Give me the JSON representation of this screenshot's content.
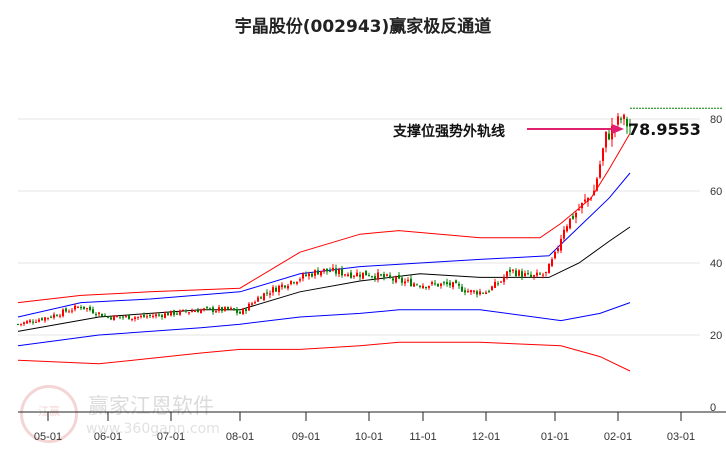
{
  "title": "宇晶股份(002943)赢家极反通道",
  "watermark": {
    "name": "赢家江恩软件",
    "url": "www.360gann.com",
    "seal": "江赢恩家"
  },
  "annotation": {
    "label": "支撑位强势外轨线",
    "value": "78.9553"
  },
  "colors": {
    "up": "#ff0000",
    "down": "#008000",
    "mid": "#000000",
    "inner": "#0000ff",
    "outer": "#ff0000",
    "arrow": "#e0206f"
  },
  "chart_data": {
    "type": "candlestick",
    "title": "宇晶股份(002943)赢家极反通道",
    "ylim": [
      0,
      85
    ],
    "xlim": [
      0,
      228
    ],
    "yticks": [
      0,
      20,
      40,
      60,
      80
    ],
    "xticks": [
      {
        "i": 10,
        "label": "05-01"
      },
      {
        "i": 30,
        "label": "06-01"
      },
      {
        "i": 51,
        "label": "07-01"
      },
      {
        "i": 74,
        "label": "08-01"
      },
      {
        "i": 96,
        "label": "09-01"
      },
      {
        "i": 117,
        "label": "10-01"
      },
      {
        "i": 135,
        "label": "11-01"
      },
      {
        "i": 156,
        "label": "12-01"
      },
      {
        "i": 179,
        "label": "01-01"
      },
      {
        "i": 200,
        "label": "02-01"
      },
      {
        "i": 221,
        "label": "03-01"
      }
    ],
    "price": [
      [
        0,
        23
      ],
      [
        10,
        25
      ],
      [
        21,
        28
      ],
      [
        30,
        25
      ],
      [
        41,
        25
      ],
      [
        51,
        26
      ],
      [
        61,
        27
      ],
      [
        71,
        27
      ],
      [
        74,
        26
      ],
      [
        81,
        31
      ],
      [
        91,
        35
      ],
      [
        101,
        38
      ],
      [
        111,
        37
      ],
      [
        117,
        37
      ],
      [
        127,
        35
      ],
      [
        135,
        34
      ],
      [
        144,
        34
      ],
      [
        151,
        32
      ],
      [
        156,
        32
      ],
      [
        161,
        35
      ],
      [
        164,
        38
      ],
      [
        171,
        36
      ],
      [
        176,
        37
      ],
      [
        179,
        42
      ],
      [
        182,
        50
      ],
      [
        187,
        55
      ],
      [
        192,
        60
      ],
      [
        196,
        75
      ],
      [
        199,
        78
      ],
      [
        201,
        80
      ],
      [
        204,
        78
      ]
    ],
    "series": [
      {
        "name": "mid",
        "points": [
          [
            0,
            21
          ],
          [
            27,
            25
          ],
          [
            61,
            27
          ],
          [
            74,
            27
          ],
          [
            94,
            32
          ],
          [
            114,
            35
          ],
          [
            134,
            37
          ],
          [
            154,
            36
          ],
          [
            177,
            36
          ],
          [
            187,
            40
          ],
          [
            197,
            46
          ],
          [
            204,
            50
          ]
        ]
      },
      {
        "name": "inner-upper",
        "points": [
          [
            0,
            25
          ],
          [
            21,
            29
          ],
          [
            44,
            30
          ],
          [
            74,
            32
          ],
          [
            94,
            37
          ],
          [
            114,
            39
          ],
          [
            134,
            40
          ],
          [
            154,
            41
          ],
          [
            177,
            42
          ],
          [
            187,
            50
          ],
          [
            197,
            58
          ],
          [
            204,
            65
          ]
        ]
      },
      {
        "name": "inner-lower",
        "points": [
          [
            0,
            17
          ],
          [
            27,
            20
          ],
          [
            61,
            22
          ],
          [
            74,
            23
          ],
          [
            94,
            25
          ],
          [
            114,
            26
          ],
          [
            127,
            27
          ],
          [
            154,
            27
          ],
          [
            181,
            24
          ],
          [
            194,
            26
          ],
          [
            204,
            29
          ]
        ]
      },
      {
        "name": "outer-upper",
        "points": [
          [
            0,
            29
          ],
          [
            21,
            31
          ],
          [
            44,
            32
          ],
          [
            74,
            33
          ],
          [
            94,
            43
          ],
          [
            114,
            48
          ],
          [
            127,
            49
          ],
          [
            154,
            47
          ],
          [
            174,
            47
          ],
          [
            181,
            51
          ],
          [
            191,
            58
          ],
          [
            197,
            66
          ],
          [
            204,
            76
          ]
        ]
      },
      {
        "name": "outer-lower",
        "points": [
          [
            0,
            13
          ],
          [
            27,
            12
          ],
          [
            61,
            15
          ],
          [
            74,
            16
          ],
          [
            94,
            16
          ],
          [
            114,
            17
          ],
          [
            127,
            18
          ],
          [
            154,
            18
          ],
          [
            181,
            17
          ],
          [
            194,
            14
          ],
          [
            204,
            10
          ]
        ]
      }
    ],
    "reference_line": 83
  }
}
